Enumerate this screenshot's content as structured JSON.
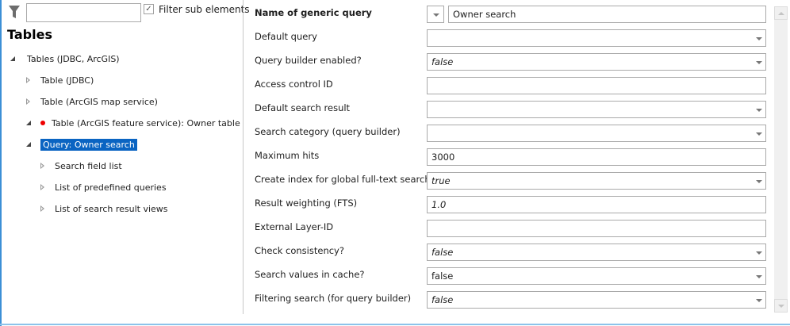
{
  "colors": {
    "accent": "#0a64c2",
    "modified_dot": "#e00000",
    "frame": "#3c8fd6"
  },
  "filter": {
    "icon": "filter-icon",
    "value": "",
    "checkbox_label": "Filter sub elements",
    "checked": true
  },
  "tree": {
    "title": "Tables",
    "items": [
      {
        "label": "Tables (JDBC, ArcGIS)",
        "level": 0,
        "expanded": true
      },
      {
        "label": "Table (JDBC)",
        "level": 1,
        "expanded": false
      },
      {
        "label": "Table (ArcGIS map service)",
        "level": 1,
        "expanded": false
      },
      {
        "label": "Table (ArcGIS feature service): Owner table",
        "level": 1,
        "expanded": true,
        "modified": true
      },
      {
        "label": "Query: Owner search",
        "level": 2,
        "expanded": true,
        "selected": true
      },
      {
        "label": "Search field list",
        "level": 3,
        "expanded": false
      },
      {
        "label": "List of predefined queries",
        "level": 3,
        "expanded": false
      },
      {
        "label": "List of search result views",
        "level": 3,
        "expanded": false
      }
    ]
  },
  "properties": [
    {
      "label": "Name of generic query",
      "value": "Owner search",
      "type": "name",
      "bold": true
    },
    {
      "label": "Default query",
      "value": "",
      "type": "dropdown"
    },
    {
      "label": "Query builder enabled?",
      "value": "false",
      "type": "dropdown",
      "italic": true
    },
    {
      "label": "Access control ID",
      "value": "",
      "type": "text"
    },
    {
      "label": "Default search result",
      "value": "",
      "type": "dropdown"
    },
    {
      "label": "Search category (query builder)",
      "value": "",
      "type": "dropdown"
    },
    {
      "label": "Maximum hits",
      "value": "3000",
      "type": "text"
    },
    {
      "label": "Create index for global full-text search?",
      "value": "true",
      "type": "dropdown",
      "italic": true
    },
    {
      "label": "Result weighting (FTS)",
      "value": "1.0",
      "type": "text",
      "italic": true
    },
    {
      "label": "External Layer-ID",
      "value": "",
      "type": "text"
    },
    {
      "label": "Check consistency?",
      "value": "false",
      "type": "dropdown",
      "italic": true
    },
    {
      "label": "Search values in cache?",
      "value": "false",
      "type": "dropdown"
    },
    {
      "label": "Filtering search (for query builder)",
      "value": "false",
      "type": "dropdown",
      "italic": true
    }
  ]
}
